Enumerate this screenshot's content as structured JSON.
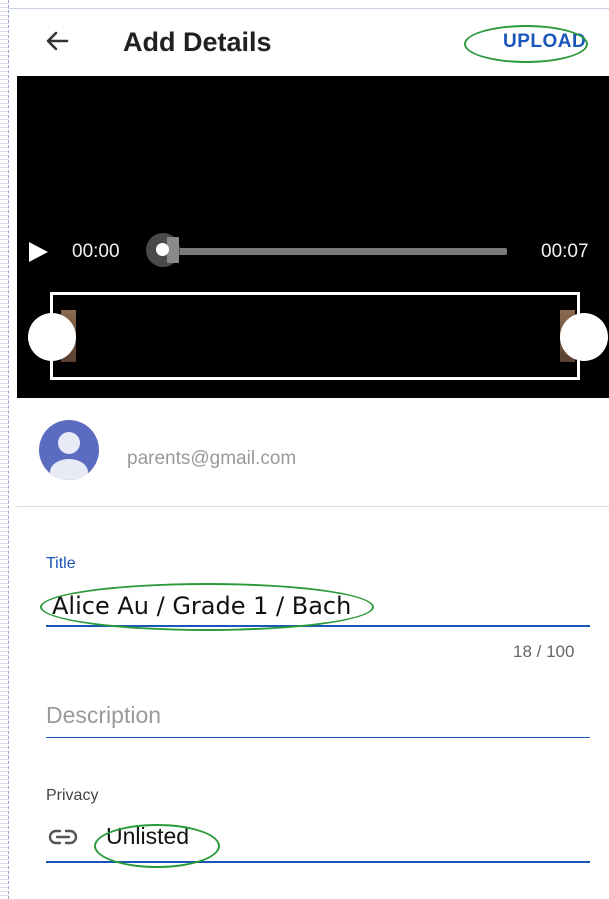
{
  "header": {
    "title": "Add Details",
    "upload_label": "UPLOAD",
    "back_icon": "arrow-left-icon"
  },
  "video": {
    "current_time": "00:00",
    "total_time": "00:07",
    "progress": 0.0,
    "play_icon": "play-icon"
  },
  "account": {
    "email": "parents@gmail.com",
    "avatar_icon": "person-avatar-icon"
  },
  "form": {
    "title_label": "Title",
    "title_value": "Alice Au / Grade 1 / Bach",
    "char_count": "18 / 100",
    "description_placeholder": "Description",
    "privacy_label": "Privacy",
    "privacy_value": "Unlisted",
    "privacy_icon": "link-icon"
  },
  "colors": {
    "accent": "#1a56b8",
    "annotation": "#2a9a3a",
    "avatar_bg": "#5b6bc0"
  }
}
